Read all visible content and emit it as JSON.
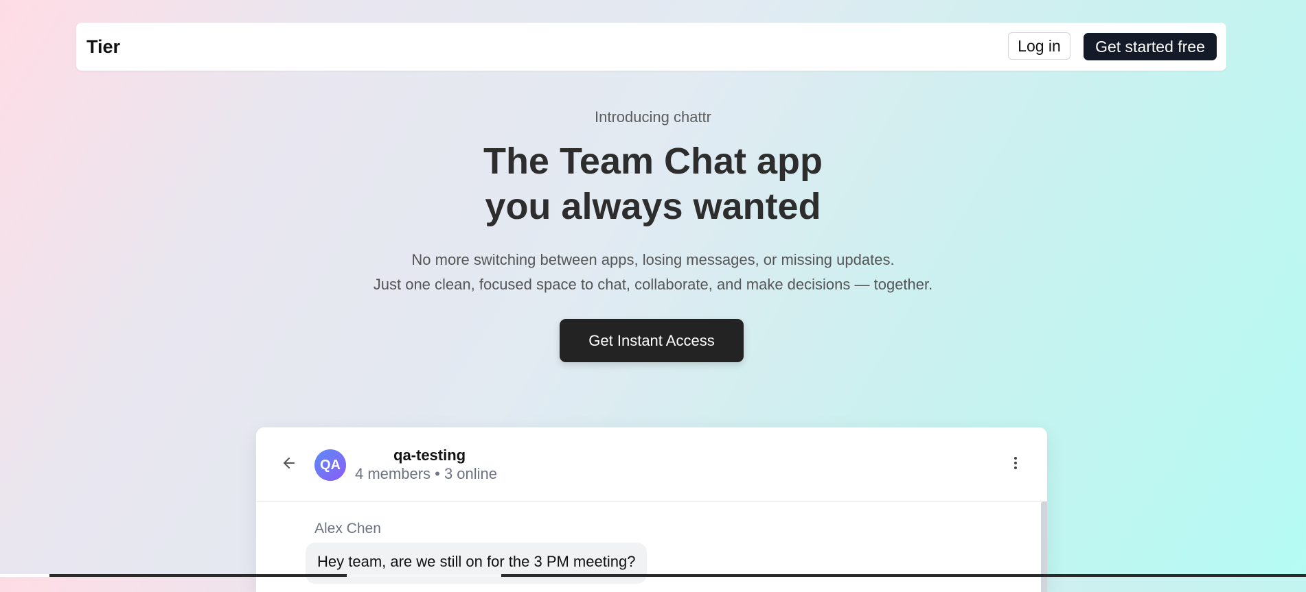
{
  "nav": {
    "brand": "Tier",
    "login_label": "Log in",
    "get_started_label": "Get started free"
  },
  "hero": {
    "kicker": "Introducing chattr",
    "headline_line1": "The Team Chat app",
    "headline_line2": "you always wanted",
    "subtext_line1": "No more switching between apps, losing messages, or missing updates.",
    "subtext_line2": "Just one clean, focused space to chat, collaborate, and make decisions — together.",
    "cta_label": "Get Instant Access"
  },
  "chat": {
    "avatar_initials": "QA",
    "channel_name": "qa-testing",
    "meta": "4 members • 3 online",
    "icons": {
      "back": "arrow-left-icon",
      "more": "more-vertical-icon"
    },
    "messages": [
      {
        "sender": "Alex Chen",
        "text": "Hey team, are we still on for the 3 PM meeting?"
      }
    ]
  },
  "colors": {
    "primary_button": "#141a28",
    "cta_button": "#232323",
    "avatar_gradient_start": "#5b8cf5",
    "avatar_gradient_end": "#8b5cf6"
  }
}
